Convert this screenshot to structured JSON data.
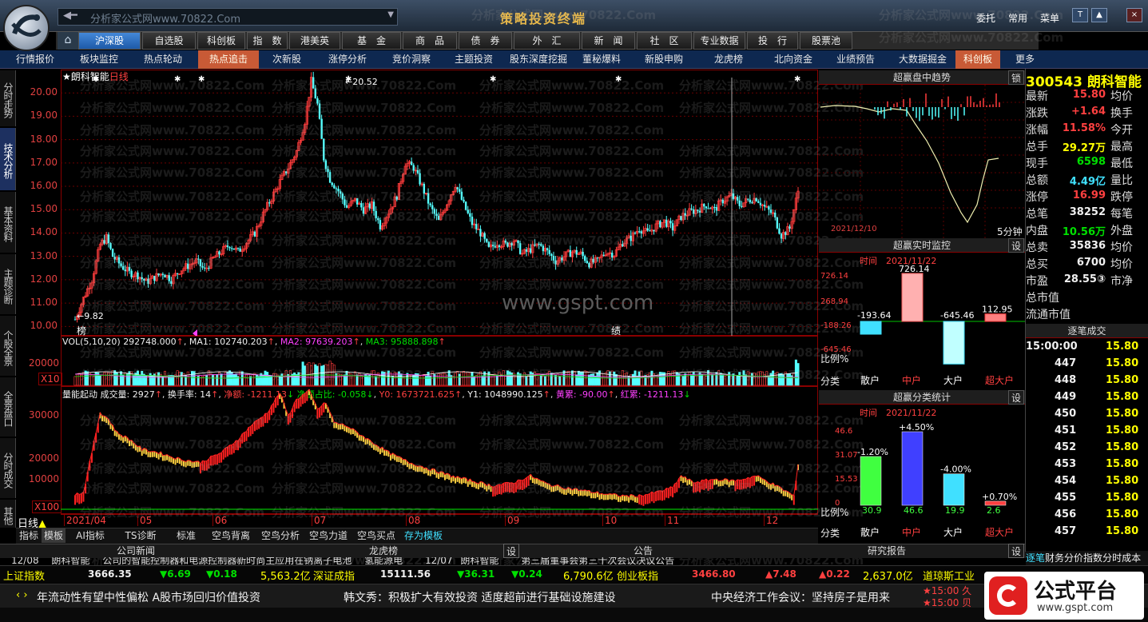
{
  "window": {
    "address_text": "分析家公式网www.70822.Com",
    "title": "策略投资终端",
    "toplinks": [
      "委托",
      "常用",
      "菜单"
    ],
    "win_buttons": [
      "T",
      "▲",
      "×"
    ]
  },
  "menu": [
    {
      "label": "沪深股",
      "active": true
    },
    {
      "label": "自选股"
    },
    {
      "label": "科创板"
    },
    {
      "label": "指　数"
    },
    {
      "label": "港美英"
    },
    {
      "label": "基　金"
    },
    {
      "label": "商　品"
    },
    {
      "label": "债　券"
    },
    {
      "label": "外　汇"
    },
    {
      "label": "新　闻"
    },
    {
      "label": "社　区"
    },
    {
      "label": "专业数据"
    },
    {
      "label": "投　行"
    },
    {
      "label": "股票池"
    }
  ],
  "subnav": [
    {
      "label": "行情报价"
    },
    {
      "label": "板块监控"
    },
    {
      "label": "热点轮动"
    },
    {
      "label": "热点追击",
      "active": true
    },
    {
      "label": "次新股"
    },
    {
      "label": "涨停分析"
    },
    {
      "label": "竞价洞察"
    },
    {
      "label": "主题投资"
    },
    {
      "label": "股东深度挖掘"
    },
    {
      "label": "董秘爆料"
    },
    {
      "label": "新股申购"
    },
    {
      "label": "龙虎榜"
    },
    {
      "label": "北向资金"
    },
    {
      "label": "业绩预告"
    },
    {
      "label": "大数据掘金"
    },
    {
      "label": "科创板",
      "active": true
    },
    {
      "label": "更多"
    }
  ],
  "left_tabs": [
    "分时走势",
    "技术分析",
    "基本资料",
    "主题诊断",
    "个股全景",
    "全景盘口",
    "分时成交",
    "其他"
  ],
  "stock": {
    "code": "300543",
    "name": "朗科智能",
    "chart_label": "★朗科智能",
    "period": "日线"
  },
  "main_chart": {
    "yticks": [
      "20.00",
      "19.00",
      "18.00",
      "17.00",
      "16.00",
      "15.00",
      "14.00",
      "13.00",
      "12.00",
      "11.00",
      "10.00"
    ],
    "high_label": "20.52",
    "low_label": "9.82",
    "marker_bang": "榜",
    "marker_ji": "绩",
    "watermark": "www.gspt.com"
  },
  "chart_data": {
    "type": "candlestick",
    "x_range": [
      "2021/04",
      "2021/12"
    ],
    "ylim": [
      9.6,
      21
    ],
    "price_trend": [
      [
        0,
        10.3
      ],
      [
        4,
        11.2
      ],
      [
        8,
        12.0
      ],
      [
        12,
        13.5
      ],
      [
        15,
        13.8
      ],
      [
        18,
        13.0
      ],
      [
        22,
        12.6
      ],
      [
        26,
        12.3
      ],
      [
        30,
        12.2
      ],
      [
        34,
        11.9
      ],
      [
        38,
        12.1
      ],
      [
        42,
        12.3
      ],
      [
        46,
        12.0
      ],
      [
        50,
        12.4
      ],
      [
        54,
        12.6
      ],
      [
        58,
        12.8
      ],
      [
        62,
        12.4
      ],
      [
        66,
        12.9
      ],
      [
        70,
        13.2
      ],
      [
        74,
        13.5
      ],
      [
        78,
        13.2
      ],
      [
        82,
        13.6
      ],
      [
        86,
        14.0
      ],
      [
        90,
        14.8
      ],
      [
        94,
        15.5
      ],
      [
        98,
        16.2
      ],
      [
        102,
        16.8
      ],
      [
        106,
        17.5
      ],
      [
        110,
        18.8
      ],
      [
        113,
        20.5
      ],
      [
        116,
        19.5
      ],
      [
        119,
        17.2
      ],
      [
        122,
        16.3
      ],
      [
        126,
        15.8
      ],
      [
        130,
        15.1
      ],
      [
        134,
        15.4
      ],
      [
        138,
        15.0
      ],
      [
        142,
        15.2
      ],
      [
        146,
        14.3
      ],
      [
        150,
        14.9
      ],
      [
        154,
        15.6
      ],
      [
        158,
        17.0
      ],
      [
        162,
        16.8
      ],
      [
        166,
        16.0
      ],
      [
        170,
        15.1
      ],
      [
        174,
        14.5
      ],
      [
        178,
        15.3
      ],
      [
        182,
        16.1
      ],
      [
        186,
        15.2
      ],
      [
        190,
        14.4
      ],
      [
        194,
        14.0
      ],
      [
        198,
        13.3
      ],
      [
        202,
        13.6
      ],
      [
        206,
        13.5
      ],
      [
        210,
        13.7
      ],
      [
        214,
        13.1
      ],
      [
        218,
        13.3
      ],
      [
        222,
        13.5
      ],
      [
        226,
        13.2
      ],
      [
        230,
        12.8
      ],
      [
        234,
        13.0
      ],
      [
        238,
        13.2
      ],
      [
        242,
        13.1
      ],
      [
        246,
        12.7
      ],
      [
        250,
        12.8
      ],
      [
        254,
        13.2
      ],
      [
        258,
        13.1
      ],
      [
        262,
        13.6
      ],
      [
        266,
        13.8
      ],
      [
        270,
        14.2
      ],
      [
        274,
        14.0
      ],
      [
        278,
        14.3
      ],
      [
        282,
        14.5
      ],
      [
        286,
        14.2
      ],
      [
        290,
        14.7
      ],
      [
        294,
        14.9
      ],
      [
        298,
        15.0
      ],
      [
        302,
        15.2
      ],
      [
        306,
        15.0
      ],
      [
        310,
        15.4
      ],
      [
        314,
        15.6
      ],
      [
        318,
        15.2
      ],
      [
        322,
        15.4
      ],
      [
        326,
        15.5
      ],
      [
        330,
        15.1
      ],
      [
        334,
        14.8
      ],
      [
        338,
        13.9
      ],
      [
        342,
        14.2
      ],
      [
        346,
        15.8
      ]
    ],
    "volume": {
      "label": "VOL(5,10,20)",
      "value": "292748.000",
      "ma1": "102740.203",
      "ma2": "97639.203",
      "ma3": "95888.898",
      "yticks": [
        "20000"
      ],
      "scale": "X10"
    },
    "xticks": [
      "2021/04",
      "05",
      "06",
      "07",
      "08",
      "09",
      "10",
      "11",
      "12"
    ]
  },
  "indicator": {
    "name": "量能起动",
    "vol": "成交量: 2927",
    "turn": "换手率: 14",
    "net": "净额: -1211.13",
    "net_ratio": "净额占比: -0.058",
    "y0": "Y0: 1673721.625",
    "y1": "Y1: 1048990.125",
    "yellow": "黄累: -90.00",
    "red": "红累: -1211.13",
    "yticks": [
      "30000",
      "20000",
      "10000"
    ],
    "scale": "X100"
  },
  "bottom_tabs": [
    "指标",
    "模板",
    "AI指标",
    "TS诊断",
    "标准",
    "空鸟背离",
    "空鸟分析",
    "空鸟力道",
    "空鸟买点",
    "存为模板"
  ],
  "period_label": "日线",
  "news_tabs": [
    "公司新闻",
    "龙虎榜",
    "设",
    "公告",
    "研究报告",
    "设"
  ],
  "news_line": {
    "date": "12/08",
    "item1": "朗科智能",
    "item2": "公司的智能控制器和电源控制器新时尚主应用在钠离子电池",
    "item3": "氢能源电",
    "date2": "12/07",
    "item4": "朗科智能",
    "item5": "第三届董事会第三十次会议决议公告"
  },
  "index_bar": [
    {
      "name": "上证指数",
      "value": "3666.35",
      "chg": "▼6.69",
      "pct": "▼0.18",
      "amt": "5,563.2亿"
    },
    {
      "name": "深证成指",
      "value": "15111.56",
      "chg": "▼36.31",
      "pct": "▼0.24",
      "amt": "6,790.6亿"
    },
    {
      "name": "创业板指",
      "value": "3466.80",
      "chg": "▲7.48",
      "pct": "▲0.22",
      "amt": "2,637.0亿"
    },
    {
      "name": "道琼斯工业",
      "value": "",
      "chg": "",
      "pct": "",
      "amt": ""
    }
  ],
  "ticker": [
    "年流动性有望中性偏松 A股市场回归价值投资",
    "韩文秀：积极扩大有效投资 适度超前进行基础设施建设",
    "中央经济工作会议：坚持房子是用来"
  ],
  "ticker_right": [
    "★15:00 久",
    "★15:00 贝"
  ],
  "brand": {
    "name": "公式平台",
    "url": "www.gspt.com"
  },
  "trend_panel": {
    "title": "超赢盘中趋势",
    "lock": "锁",
    "date": "2021/12/10",
    "period": "5分钟"
  },
  "monitor_panel": {
    "title": "超赢实时监控",
    "setting": "设",
    "time_label": "时间",
    "date": "2021/11/22",
    "yticks": [
      "726.14",
      "268.94",
      "-188.26",
      "-645.46"
    ],
    "ratio": "比例%",
    "cat_label": "分类",
    "bars": [
      {
        "label": "散户",
        "value": "-193.64"
      },
      {
        "label": "中户",
        "value": "726.14"
      },
      {
        "label": "大户",
        "value": "-645.46"
      },
      {
        "label": "超大户",
        "value": "112.95"
      }
    ]
  },
  "class_panel": {
    "title": "超赢分类统计",
    "setting": "设",
    "time_label": "时间",
    "date": "2021/11/22",
    "yticks": [
      "46.6",
      "31.07",
      "15.53",
      "0"
    ],
    "ratio": "比例%",
    "cat_label": "分类",
    "bars": [
      {
        "label": "散户",
        "pct": 30.9,
        "chg": "-1.20%"
      },
      {
        "label": "中户",
        "pct": 46.6,
        "chg": "+4.50%"
      },
      {
        "label": "大户",
        "pct": 19.9,
        "chg": "-4.00%"
      },
      {
        "label": "超大户",
        "pct": 2.6,
        "chg": "+0.70%"
      }
    ]
  },
  "quote": {
    "rows": [
      {
        "k": "最新",
        "v": "15.80",
        "vc": "r",
        "k2": "均价"
      },
      {
        "k": "涨跌",
        "v": "+1.64",
        "vc": "r",
        "k2": "换手"
      },
      {
        "k": "涨幅",
        "v": "11.58%",
        "vc": "r",
        "k2": "今开"
      },
      {
        "k": "总手",
        "v": "29.27万",
        "vc": "y",
        "k2": "最高"
      },
      {
        "k": "现手",
        "v": "6598",
        "vc": "g",
        "k2": "最低"
      },
      {
        "k": "总额",
        "v": "4.49亿",
        "vc": "c",
        "k2": "量比"
      },
      {
        "k": "涨停",
        "v": "16.99",
        "vc": "r",
        "k2": "跌停"
      },
      {
        "k": "总笔",
        "v": "38252",
        "vc": "w",
        "k2": "每笔"
      },
      {
        "k": "内盘",
        "v": "10.56万",
        "vc": "g",
        "k2": "外盘"
      },
      {
        "k": "总卖",
        "v": "35836",
        "vc": "w",
        "k2": "均价"
      },
      {
        "k": "总买",
        "v": "6700",
        "vc": "w",
        "k2": "均价"
      },
      {
        "k": "市盈",
        "v": "28.55③",
        "vc": "w",
        "k2": "市净"
      },
      {
        "k": "总市值",
        "v": "",
        "vc": "w",
        "k2": ""
      },
      {
        "k": "流通市值",
        "v": "",
        "vc": "w",
        "k2": ""
      }
    ],
    "tick_title": "逐笔成交",
    "ticks": [
      {
        "t": "15:00:00",
        "p": "15.80"
      },
      {
        "t": "447",
        "p": "15.80"
      },
      {
        "t": "448",
        "p": "15.80"
      },
      {
        "t": "449",
        "p": "15.80"
      },
      {
        "t": "450",
        "p": "15.80"
      },
      {
        "t": "451",
        "p": "15.80"
      },
      {
        "t": "452",
        "p": "15.80"
      },
      {
        "t": "453",
        "p": "15.80"
      },
      {
        "t": "454",
        "p": "15.80"
      },
      {
        "t": "455",
        "p": "15.80"
      },
      {
        "t": "456",
        "p": "15.80"
      },
      {
        "t": "457",
        "p": "15.80"
      }
    ],
    "bottom_tabs": [
      "逐笔",
      "财务",
      "分价",
      "指数",
      "分时",
      "成本"
    ]
  }
}
